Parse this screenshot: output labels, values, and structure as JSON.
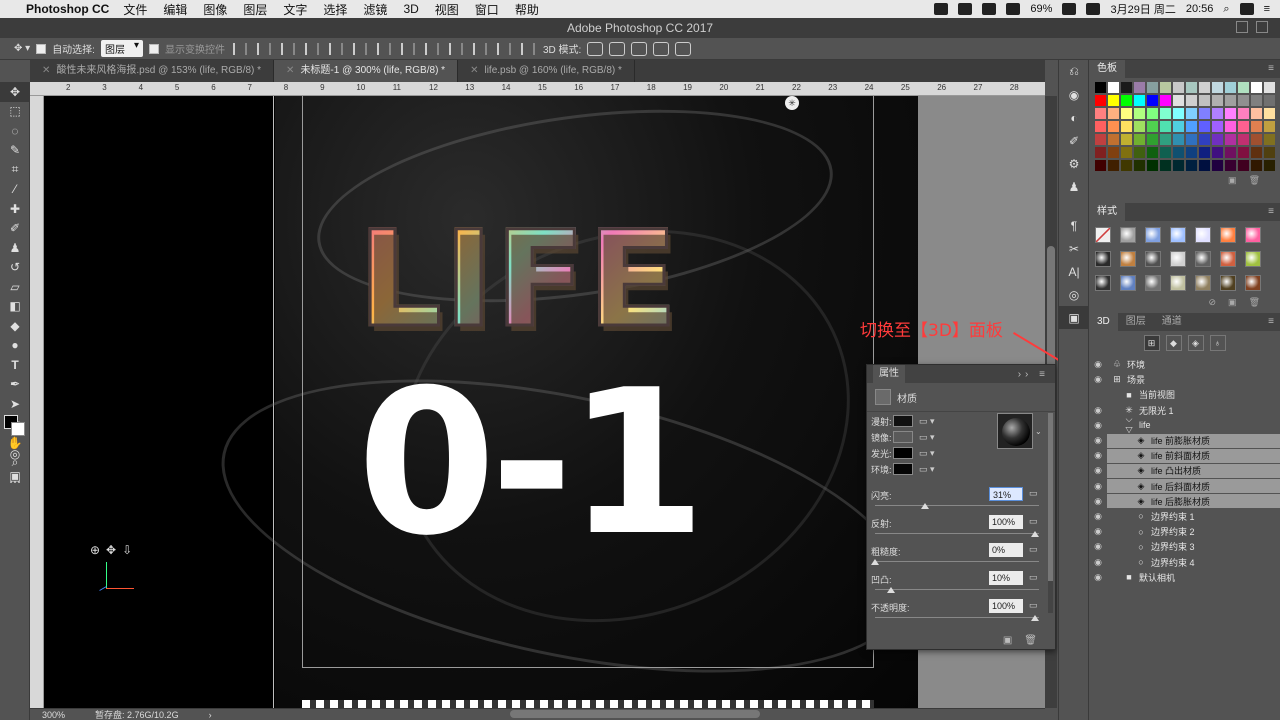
{
  "menubar": {
    "app": "Photoshop CC",
    "items": [
      "文件",
      "编辑",
      "图像",
      "图层",
      "文字",
      "选择",
      "滤镜",
      "3D",
      "视图",
      "窗口",
      "帮助"
    ],
    "battery": "69%",
    "date": "3月29日 周二",
    "time": "20:56",
    "user": "[]"
  },
  "window": {
    "title": "Adobe Photoshop CC 2017"
  },
  "optionsbar": {
    "auto_select_label": "自动选择:",
    "auto_select_value": "图层",
    "show_transform": "显示变换控件",
    "mode_3d_label": "3D 模式:"
  },
  "tabs": [
    {
      "label": "酸性未来风格海报.psd @ 153% (life, RGB/8) *",
      "active": false
    },
    {
      "label": "未标题-1 @ 300% (life, RGB/8) *",
      "active": true
    },
    {
      "label": "life.psb @ 160% (life, RGB/8) *",
      "active": false
    }
  ],
  "ruler_ticks": [
    "2",
    "3",
    "4",
    "5",
    "6",
    "7",
    "8",
    "9",
    "10",
    "11",
    "12",
    "13",
    "14",
    "15",
    "16",
    "17",
    "18",
    "19",
    "20",
    "21",
    "22",
    "23",
    "24",
    "25",
    "26",
    "27",
    "28"
  ],
  "canvas": {
    "title_text": "LIFE",
    "number_text": "0-1"
  },
  "annotation": {
    "text": "切换至【3D】面板"
  },
  "properties": {
    "tab": "属性",
    "section": "材质",
    "material_rows": [
      {
        "label": "漫射:",
        "color": "#111111"
      },
      {
        "label": "镜像:",
        "color": "#5a5a5a"
      },
      {
        "label": "发光:",
        "color": "#000000"
      },
      {
        "label": "环境:",
        "color": "#050505"
      }
    ],
    "sliders": [
      {
        "label": "闪亮:",
        "value": "31%",
        "focused": true,
        "fraction": 0.31
      },
      {
        "label": "反射:",
        "value": "100%",
        "focused": false,
        "fraction": 1.0
      },
      {
        "label": "粗糙度:",
        "value": "0%",
        "focused": false,
        "fraction": 0.0
      },
      {
        "label": "凹凸:",
        "value": "10%",
        "focused": false,
        "fraction": 0.1
      },
      {
        "label": "不透明度:",
        "value": "100%",
        "focused": false,
        "fraction": 1.0
      }
    ]
  },
  "swatches_panel": {
    "title": "色板"
  },
  "styles_panel": {
    "title": "样式"
  },
  "panel3d": {
    "tabs": [
      {
        "label": "3D",
        "active": true
      },
      {
        "label": "图层",
        "active": false
      },
      {
        "label": "通道",
        "active": false
      }
    ],
    "tree": [
      {
        "name": "环境",
        "indent": 0,
        "eye": true,
        "selected": false,
        "glyph": "env"
      },
      {
        "name": "场景",
        "indent": 0,
        "eye": true,
        "selected": false,
        "glyph": "scene"
      },
      {
        "name": "当前视图",
        "indent": 1,
        "eye": false,
        "selected": false,
        "glyph": "camera"
      },
      {
        "name": "无限光 1",
        "indent": 1,
        "eye": true,
        "selected": false,
        "glyph": "light"
      },
      {
        "name": "life",
        "indent": 1,
        "eye": true,
        "selected": false,
        "glyph": "mesh"
      },
      {
        "name": "life 前膨胀材质",
        "indent": 2,
        "eye": true,
        "selected": true,
        "glyph": "material"
      },
      {
        "name": "life 前斜面材质",
        "indent": 2,
        "eye": true,
        "selected": true,
        "glyph": "material"
      },
      {
        "name": "life 凸出材质",
        "indent": 2,
        "eye": true,
        "selected": true,
        "glyph": "material"
      },
      {
        "name": "life 后斜面材质",
        "indent": 2,
        "eye": true,
        "selected": true,
        "glyph": "material"
      },
      {
        "name": "life 后膨胀材质",
        "indent": 2,
        "eye": true,
        "selected": true,
        "glyph": "material"
      },
      {
        "name": "边界约束 1",
        "indent": 2,
        "eye": true,
        "selected": false,
        "glyph": "constraint"
      },
      {
        "name": "边界约束 2",
        "indent": 2,
        "eye": true,
        "selected": false,
        "glyph": "constraint"
      },
      {
        "name": "边界约束 3",
        "indent": 2,
        "eye": true,
        "selected": false,
        "glyph": "constraint"
      },
      {
        "name": "边界约束 4",
        "indent": 2,
        "eye": true,
        "selected": false,
        "glyph": "constraint"
      },
      {
        "name": "默认相机",
        "indent": 1,
        "eye": true,
        "selected": false,
        "glyph": "camera"
      }
    ]
  },
  "status": {
    "zoom": "300%",
    "scratch": "暂存盘: 2.76G/10.2G"
  },
  "swatch_colors": [
    "#000000",
    "#ffffff",
    "#1a1a1a",
    "#9a7ca8",
    "#86a0a0",
    "#b8c8a0",
    "#c8c8c8",
    "#a8c8c0",
    "#d0d0d0",
    "#c0d8e0",
    "#a0d0d8",
    "#b0e0c0",
    "#ffffff",
    "#e0e0e0",
    "#ff0000",
    "#ffff00",
    "#00ff00",
    "#00ffff",
    "#0000ff",
    "#ff00ff",
    "#e0e0e0",
    "#d0d0d0",
    "#c0c0c0",
    "#b0b0b0",
    "#a0a0a0",
    "#909090",
    "#808080",
    "#707070",
    "#ff8080",
    "#ffb080",
    "#ffff80",
    "#b0ff80",
    "#80ff80",
    "#80ffd0",
    "#80ffff",
    "#80d0ff",
    "#8080ff",
    "#b080ff",
    "#ff80ff",
    "#ff80c0",
    "#ffc0a0",
    "#ffe0a0",
    "#ff6060",
    "#ff9050",
    "#ffe060",
    "#a0e060",
    "#50d050",
    "#50e0b0",
    "#50d0e0",
    "#50a0ff",
    "#6060ff",
    "#a060ff",
    "#ff60e0",
    "#ff6090",
    "#e08050",
    "#c0a040",
    "#c04040",
    "#c07030",
    "#c0b030",
    "#70b030",
    "#30a030",
    "#30a080",
    "#3090b0",
    "#3070c0",
    "#3040c0",
    "#7030c0",
    "#b030a0",
    "#c03070",
    "#a05030",
    "#807020",
    "#802020",
    "#804010",
    "#807010",
    "#406010",
    "#106010",
    "#106050",
    "#105070",
    "#104080",
    "#102080",
    "#401080",
    "#701060",
    "#801040",
    "#603010",
    "#504010",
    "#400000",
    "#402000",
    "#403800",
    "#203000",
    "#003000",
    "#003020",
    "#002830",
    "#002040",
    "#001040",
    "#200040",
    "#380030",
    "#400020",
    "#301800",
    "#282000"
  ],
  "style_colors": [
    "#d8a070",
    "#a0a0a0",
    "#80a0e0",
    "#a0c0ff",
    "#e0e0ff",
    "#ff8040",
    "#ff60a0",
    "#2a2a2a",
    "#c08040",
    "#505050",
    "#d0d0d0",
    "#606060",
    "#d06040",
    "#a0c040",
    "#303030",
    "#6080c0",
    "#707070",
    "#c0c0a0",
    "#908060",
    "#504020",
    "#804020"
  ]
}
